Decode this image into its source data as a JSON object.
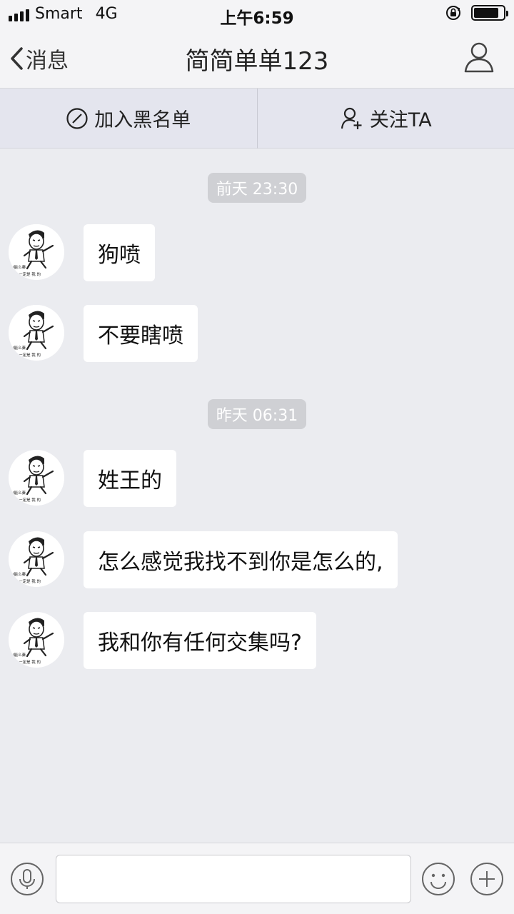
{
  "status_bar": {
    "carrier": "Smart",
    "network": "4G",
    "time": "上午6:59",
    "battery_level": 0.85
  },
  "nav": {
    "back_label": "消息",
    "title": "简简单单123",
    "profile_icon": "person-outline-icon"
  },
  "actions": {
    "blacklist_label": "加入黑名单",
    "blacklist_icon": "block-icon",
    "follow_label": "关注TA",
    "follow_icon": "add-user-icon"
  },
  "messages": [
    {
      "type": "timestamp",
      "text": "前天 23:30"
    },
    {
      "type": "message",
      "text": "狗喷"
    },
    {
      "type": "message",
      "text": "不要瞎喷"
    },
    {
      "type": "timestamp",
      "text": "昨天 06:31"
    },
    {
      "type": "message",
      "text": "姓王的"
    },
    {
      "type": "message",
      "text": "怎么感觉我找不到你是怎么的,"
    },
    {
      "type": "message",
      "text": "我和你有任何交集吗?"
    }
  ],
  "avatar_caption": {
    "line1": "I能么秦",
    "line2": "一定是 我 的"
  },
  "input_bar": {
    "placeholder": "",
    "voice_icon": "microphone-icon",
    "emoji_icon": "smiley-icon",
    "plus_icon": "plus-icon"
  },
  "colors": {
    "background": "#ebecf0",
    "bar": "#f4f4f6",
    "action_bar": "#e4e5ee",
    "bubble": "#ffffff",
    "timestamp_pill": "#cfd0d4"
  }
}
